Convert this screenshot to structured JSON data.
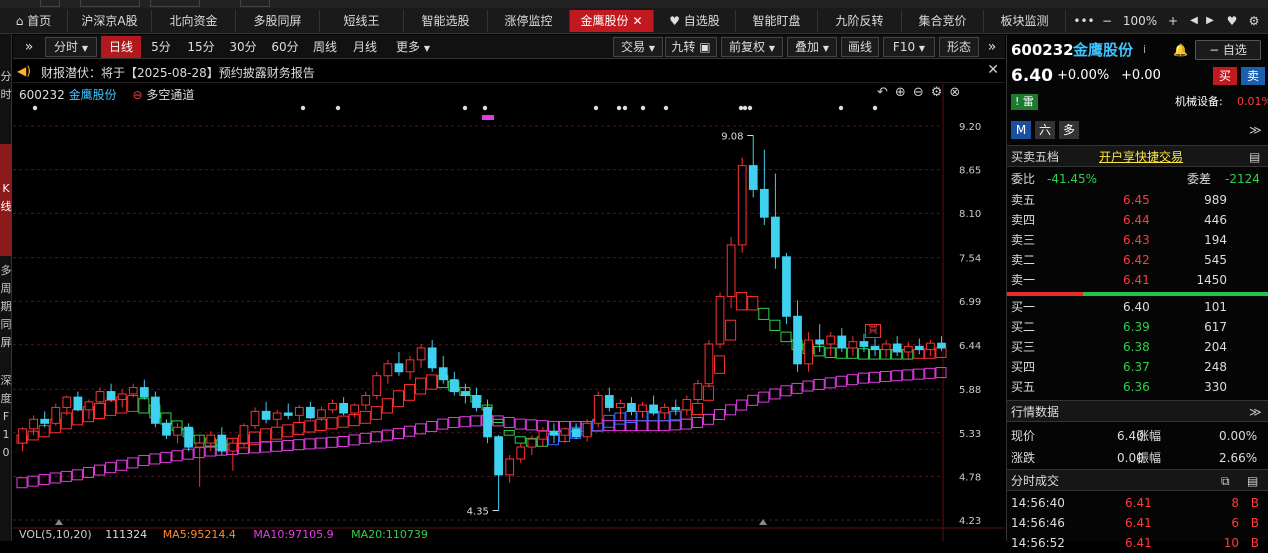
{
  "tabs": [
    {
      "label": "首页",
      "icon": "home-icon",
      "active": false
    },
    {
      "label": "沪深京A股",
      "active": false
    },
    {
      "label": "北向资金",
      "active": false
    },
    {
      "label": "多股同屏",
      "active": false
    },
    {
      "label": "短线王",
      "active": false
    },
    {
      "label": "智能选股",
      "active": false
    },
    {
      "label": "涨停监控",
      "active": false
    },
    {
      "label": "金鹰股份",
      "active": true
    },
    {
      "label": "自选股",
      "icon": "heart-icon",
      "active": false
    },
    {
      "label": "智能盯盘",
      "active": false
    },
    {
      "label": "九阶反转",
      "active": false
    },
    {
      "label": "集合竞价",
      "active": false
    },
    {
      "label": "板块监测",
      "active": false
    }
  ],
  "tabbar_right": {
    "more": "•••",
    "zoom_out": "−",
    "zoom": "100%",
    "zoom_in": "+",
    "fav": "♥"
  },
  "left_strip": {
    "item1": "分\n时",
    "item2": "K\n线",
    "item3": "多\n周\n期\n同\n屏",
    "item4": "深\n度\nF\n1\n0"
  },
  "toolbar": {
    "periods": [
      "分时",
      "日线",
      "5分",
      "15分",
      "30分",
      "60分",
      "周线",
      "月线",
      "更多"
    ],
    "active_period": "日线",
    "right": [
      "交易",
      "九转",
      "前复权",
      "叠加",
      "画线",
      "F10",
      "形态"
    ]
  },
  "notice": {
    "prefix": "财报潜伏：",
    "text": "将于【2025-08-28】预约披露财务报告"
  },
  "chart_header": {
    "code": "600232",
    "name": "金鹰股份",
    "indicator": "多空通道"
  },
  "price_axis": [
    "9.20",
    "8.65",
    "8.10",
    "7.54",
    "6.99",
    "6.44",
    "5.88",
    "5.33",
    "4.78",
    "4.23"
  ],
  "chart_data": {
    "type": "candlestick",
    "ylim": [
      4.23,
      9.2
    ],
    "high_label": "9.08",
    "low_label": "4.35",
    "bottom_bar": {
      "label": "VOL(5,10,20)",
      "vol": "111324",
      "ma5": "MA5:95214.4",
      "ma10": "MA10:97105.9",
      "ma20": "MA20:110739"
    },
    "candles": [
      [
        5.2,
        5.4,
        5.1,
        5.38
      ],
      [
        5.38,
        5.55,
        5.3,
        5.5
      ],
      [
        5.5,
        5.6,
        5.4,
        5.45
      ],
      [
        5.45,
        5.7,
        5.42,
        5.65
      ],
      [
        5.65,
        5.8,
        5.55,
        5.78
      ],
      [
        5.78,
        5.85,
        5.6,
        5.62
      ],
      [
        5.62,
        5.75,
        5.5,
        5.72
      ],
      [
        5.72,
        5.9,
        5.7,
        5.85
      ],
      [
        5.85,
        5.95,
        5.72,
        5.75
      ],
      [
        5.75,
        5.88,
        5.65,
        5.82
      ],
      [
        5.82,
        5.95,
        5.78,
        5.9
      ],
      [
        5.9,
        6.0,
        5.75,
        5.78
      ],
      [
        5.78,
        5.85,
        5.4,
        5.45
      ],
      [
        5.45,
        5.5,
        5.25,
        5.3
      ],
      [
        5.3,
        5.45,
        5.2,
        5.4
      ],
      [
        5.4,
        5.45,
        5.1,
        5.15
      ],
      [
        5.15,
        5.3,
        4.65,
        5.2
      ],
      [
        5.2,
        5.35,
        5.1,
        5.3
      ],
      [
        5.3,
        5.4,
        5.05,
        5.1
      ],
      [
        5.1,
        5.25,
        4.85,
        5.2
      ],
      [
        5.2,
        5.45,
        5.15,
        5.42
      ],
      [
        5.42,
        5.65,
        5.38,
        5.6
      ],
      [
        5.6,
        5.72,
        5.45,
        5.5
      ],
      [
        5.5,
        5.62,
        5.4,
        5.58
      ],
      [
        5.58,
        5.7,
        5.5,
        5.55
      ],
      [
        5.55,
        5.68,
        5.45,
        5.65
      ],
      [
        5.65,
        5.72,
        5.5,
        5.52
      ],
      [
        5.52,
        5.66,
        5.48,
        5.62
      ],
      [
        5.62,
        5.75,
        5.58,
        5.7
      ],
      [
        5.7,
        5.78,
        5.55,
        5.58
      ],
      [
        5.58,
        5.7,
        5.52,
        5.68
      ],
      [
        5.68,
        5.85,
        5.62,
        5.8
      ],
      [
        5.8,
        6.1,
        5.75,
        6.05
      ],
      [
        6.05,
        6.25,
        5.95,
        6.2
      ],
      [
        6.2,
        6.35,
        6.05,
        6.1
      ],
      [
        6.1,
        6.3,
        6.0,
        6.25
      ],
      [
        6.25,
        6.45,
        6.15,
        6.4
      ],
      [
        6.4,
        6.5,
        6.1,
        6.15
      ],
      [
        6.15,
        6.3,
        5.95,
        6.0
      ],
      [
        6.0,
        6.1,
        5.8,
        5.85
      ],
      [
        5.85,
        5.95,
        5.7,
        5.8
      ],
      [
        5.8,
        5.9,
        5.6,
        5.65
      ],
      [
        5.65,
        5.75,
        5.2,
        5.28
      ],
      [
        5.28,
        5.3,
        4.35,
        4.8
      ],
      [
        4.8,
        5.05,
        4.7,
        5.0
      ],
      [
        5.0,
        5.2,
        4.95,
        5.15
      ],
      [
        5.15,
        5.3,
        5.05,
        5.25
      ],
      [
        5.25,
        5.4,
        5.15,
        5.35
      ],
      [
        5.35,
        5.45,
        5.2,
        5.3
      ],
      [
        5.3,
        5.4,
        5.2,
        5.38
      ],
      [
        5.38,
        5.45,
        5.25,
        5.28
      ],
      [
        5.28,
        5.5,
        5.22,
        5.45
      ],
      [
        5.45,
        5.85,
        5.4,
        5.8
      ],
      [
        5.8,
        5.9,
        5.6,
        5.65
      ],
      [
        5.65,
        5.75,
        5.5,
        5.7
      ],
      [
        5.7,
        5.78,
        5.55,
        5.6
      ],
      [
        5.6,
        5.72,
        5.52,
        5.68
      ],
      [
        5.68,
        5.8,
        5.55,
        5.58
      ],
      [
        5.58,
        5.7,
        5.5,
        5.65
      ],
      [
        5.65,
        5.75,
        5.55,
        5.62
      ],
      [
        5.62,
        5.8,
        5.55,
        5.75
      ],
      [
        5.75,
        6.0,
        5.7,
        5.95
      ],
      [
        5.95,
        6.5,
        5.9,
        6.45
      ],
      [
        6.45,
        7.1,
        6.4,
        7.05
      ],
      [
        7.05,
        7.8,
        6.9,
        7.7
      ],
      [
        7.7,
        8.8,
        7.6,
        8.7
      ],
      [
        8.7,
        9.08,
        8.3,
        8.4
      ],
      [
        8.4,
        8.9,
        7.95,
        8.05
      ],
      [
        8.05,
        8.6,
        7.4,
        7.55
      ],
      [
        7.55,
        7.6,
        6.7,
        6.8
      ],
      [
        6.8,
        7.0,
        6.1,
        6.2
      ],
      [
        6.2,
        6.6,
        6.1,
        6.5
      ],
      [
        6.5,
        6.7,
        6.35,
        6.45
      ],
      [
        6.45,
        6.6,
        6.3,
        6.55
      ],
      [
        6.55,
        6.65,
        6.35,
        6.4
      ],
      [
        6.4,
        6.55,
        6.3,
        6.48
      ],
      [
        6.48,
        6.58,
        6.35,
        6.42
      ],
      [
        6.42,
        6.52,
        6.3,
        6.38
      ],
      [
        6.38,
        6.5,
        6.28,
        6.45
      ],
      [
        6.45,
        6.55,
        6.3,
        6.35
      ],
      [
        6.35,
        6.48,
        6.25,
        6.42
      ],
      [
        6.42,
        6.52,
        6.32,
        6.38
      ],
      [
        6.38,
        6.5,
        6.3,
        6.46
      ],
      [
        6.46,
        6.55,
        6.36,
        6.4
      ]
    ],
    "band_upper": [
      5.3,
      5.35,
      5.42,
      5.5,
      5.58,
      5.62,
      5.66,
      5.7,
      5.74,
      5.78,
      5.8,
      5.76,
      5.68,
      5.58,
      5.48,
      5.38,
      5.3,
      5.26,
      5.24,
      5.26,
      5.3,
      5.34,
      5.38,
      5.4,
      5.43,
      5.46,
      5.48,
      5.5,
      5.52,
      5.54,
      5.56,
      5.6,
      5.66,
      5.76,
      5.86,
      5.94,
      6.02,
      6.06,
      6.05,
      5.98,
      5.9,
      5.8,
      5.68,
      5.5,
      5.36,
      5.28,
      5.26,
      5.28,
      5.32,
      5.36,
      5.4,
      5.44,
      5.5,
      5.55,
      5.58,
      5.6,
      5.6,
      5.6,
      5.6,
      5.6,
      5.62,
      5.7,
      5.92,
      6.3,
      6.75,
      7.1,
      7.05,
      6.9,
      6.75,
      6.6,
      6.5,
      6.45,
      6.42,
      6.4,
      6.4,
      6.4,
      6.39,
      6.38,
      6.38,
      6.38,
      6.38,
      6.38,
      6.39,
      6.4
    ],
    "band_lower": [
      5.2,
      5.24,
      5.28,
      5.33,
      5.38,
      5.43,
      5.47,
      5.51,
      5.55,
      5.58,
      5.6,
      5.58,
      5.52,
      5.44,
      5.36,
      5.28,
      5.2,
      5.15,
      5.12,
      5.12,
      5.14,
      5.18,
      5.22,
      5.25,
      5.28,
      5.31,
      5.34,
      5.36,
      5.38,
      5.4,
      5.42,
      5.45,
      5.5,
      5.58,
      5.66,
      5.74,
      5.82,
      5.88,
      5.9,
      5.86,
      5.8,
      5.72,
      5.62,
      5.46,
      5.3,
      5.2,
      5.16,
      5.16,
      5.18,
      5.22,
      5.26,
      5.3,
      5.35,
      5.4,
      5.44,
      5.46,
      5.48,
      5.48,
      5.48,
      5.48,
      5.5,
      5.56,
      5.74,
      6.08,
      6.5,
      6.88,
      6.88,
      6.76,
      6.62,
      6.48,
      6.38,
      6.33,
      6.3,
      6.28,
      6.27,
      6.27,
      6.26,
      6.26,
      6.26,
      6.26,
      6.26,
      6.27,
      6.27,
      6.28
    ],
    "band_colors": [
      "up",
      "up",
      "up",
      "up",
      "up",
      "up",
      "up",
      "up",
      "up",
      "up",
      "up",
      "down",
      "down",
      "down",
      "down",
      "down",
      "down",
      "down",
      "down",
      "up",
      "up",
      "up",
      "up",
      "up",
      "up",
      "up",
      "up",
      "up",
      "up",
      "up",
      "up",
      "up",
      "up",
      "up",
      "up",
      "up",
      "up",
      "up",
      "down",
      "down",
      "down",
      "down",
      "down",
      "down",
      "down",
      "down",
      "down",
      "down",
      "flat",
      "flat",
      "flat",
      "flat",
      "flat",
      "flat",
      "flat",
      "flat",
      "flat",
      "flat",
      "flat",
      "flat",
      "up",
      "up",
      "up",
      "up",
      "up",
      "up",
      "up",
      "down",
      "down",
      "down",
      "down",
      "down",
      "down",
      "down",
      "down",
      "down",
      "down",
      "down",
      "down",
      "down",
      "down",
      "up",
      "up",
      "up"
    ],
    "long_ma": [
      4.7,
      4.72,
      4.74,
      4.76,
      4.78,
      4.8,
      4.83,
      4.86,
      4.89,
      4.92,
      4.95,
      4.98,
      5.0,
      5.02,
      5.04,
      5.06,
      5.08,
      5.1,
      5.11,
      5.12,
      5.13,
      5.14,
      5.15,
      5.16,
      5.17,
      5.18,
      5.19,
      5.2,
      5.21,
      5.22,
      5.24,
      5.26,
      5.28,
      5.3,
      5.32,
      5.35,
      5.38,
      5.41,
      5.44,
      5.46,
      5.47,
      5.48,
      5.49,
      5.48,
      5.46,
      5.44,
      5.43,
      5.42,
      5.41,
      5.41,
      5.41,
      5.41,
      5.42,
      5.42,
      5.42,
      5.42,
      5.42,
      5.42,
      5.42,
      5.43,
      5.44,
      5.46,
      5.5,
      5.56,
      5.62,
      5.68,
      5.74,
      5.78,
      5.82,
      5.86,
      5.89,
      5.92,
      5.94,
      5.96,
      5.98,
      6.0,
      6.02,
      6.03,
      6.04,
      6.05,
      6.06,
      6.07,
      6.08,
      6.09
    ]
  },
  "right_panel": {
    "code": "600232",
    "name": "金鹰股份",
    "info_icon": "i",
    "alert": "🔔",
    "watch": "− 自选",
    "price": "6.40",
    "chg_pct": "+0.00%",
    "chg": "+0.00",
    "buy": "买",
    "sell": "卖",
    "tag": "雷",
    "sector_label": "机械设备:",
    "sector_chg": "0.01%",
    "btn_m": "M",
    "btn_six": "六",
    "btn_many": "多",
    "order_title": "买卖五档",
    "order_link": "开户享快捷交易",
    "webi_label": "委比",
    "webi": "-41.45%",
    "weicha_label": "委差",
    "weicha": "-2124",
    "asks": [
      {
        "label": "卖五",
        "price": "6.45",
        "vol": "989"
      },
      {
        "label": "卖四",
        "price": "6.44",
        "vol": "446"
      },
      {
        "label": "卖三",
        "price": "6.43",
        "vol": "194"
      },
      {
        "label": "卖二",
        "price": "6.42",
        "vol": "545"
      },
      {
        "label": "卖一",
        "price": "6.41",
        "vol": "1450"
      }
    ],
    "bids": [
      {
        "label": "买一",
        "price": "6.40",
        "vol": "101"
      },
      {
        "label": "买二",
        "price": "6.39",
        "vol": "617"
      },
      {
        "label": "买三",
        "price": "6.38",
        "vol": "204"
      },
      {
        "label": "买四",
        "price": "6.37",
        "vol": "248"
      },
      {
        "label": "买五",
        "price": "6.36",
        "vol": "330"
      }
    ],
    "quote_title": "行情数据",
    "q_price_label": "现价",
    "q_price": "6.40",
    "q_pct_label": "涨幅",
    "q_pct": "0.00%",
    "q_chg_label": "涨跌",
    "q_chg": "0.00",
    "q_amp_label": "振幅",
    "q_amp": "2.66%",
    "trades_title": "分时成交",
    "trades": [
      {
        "time": "14:56:40",
        "price": "6.41",
        "vol": "8",
        "side": "B"
      },
      {
        "time": "14:56:46",
        "price": "6.41",
        "vol": "6",
        "side": "B"
      },
      {
        "time": "14:56:52",
        "price": "6.41",
        "vol": "10",
        "side": "B"
      }
    ]
  }
}
